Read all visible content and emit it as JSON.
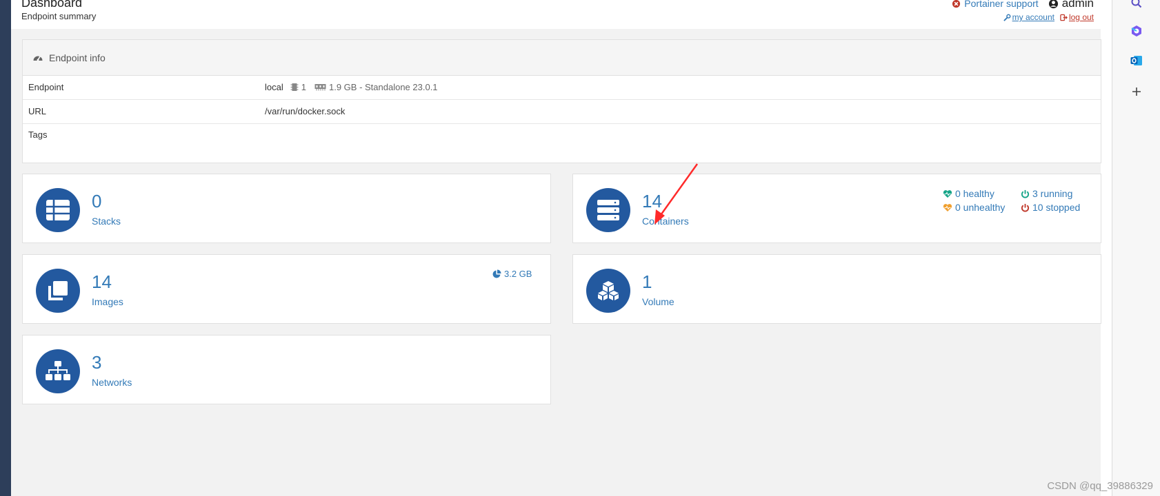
{
  "header": {
    "title": "Dashboard",
    "subtitle": "Endpoint summary",
    "support_label": "Portainer support",
    "user": "admin",
    "my_account": "my account",
    "log_out": "log out"
  },
  "endpoint_info": {
    "title": "Endpoint info",
    "rows": [
      {
        "key": "Endpoint",
        "name": "local",
        "cpu": "1",
        "memory_suffix": "1.9 GB - Standalone 23.0.1"
      },
      {
        "key": "URL",
        "value": "/var/run/docker.sock"
      },
      {
        "key": "Tags",
        "value": ""
      }
    ]
  },
  "tiles": {
    "stacks": {
      "count": "0",
      "label": "Stacks"
    },
    "containers": {
      "count": "14",
      "label": "Containers",
      "healthy": "0 healthy",
      "running": "3 running",
      "unhealthy": "0 unhealthy",
      "stopped": "10 stopped"
    },
    "images": {
      "count": "14",
      "label": "Images",
      "size": "3.2 GB"
    },
    "volumes": {
      "count": "1",
      "label": "Volume"
    },
    "networks": {
      "count": "3",
      "label": "Networks"
    }
  },
  "watermark": "CSDN @qq_39886329",
  "colors": {
    "accent": "#337ab7",
    "tile_icon_bg": "#23599f",
    "healthy": "#17a589",
    "unhealthy": "#f0a030",
    "stopped": "#c0392b",
    "annotation_arrow": "#ff2a2a"
  },
  "icons": [
    "search-icon",
    "copilot-icon",
    "outlook-icon",
    "plus-icon",
    "tachometer-icon",
    "list-icon",
    "server-icon",
    "clone-icon",
    "cubes-icon",
    "sitemap-icon",
    "pie-chart-icon",
    "heartbeat-icon",
    "power-icon"
  ]
}
